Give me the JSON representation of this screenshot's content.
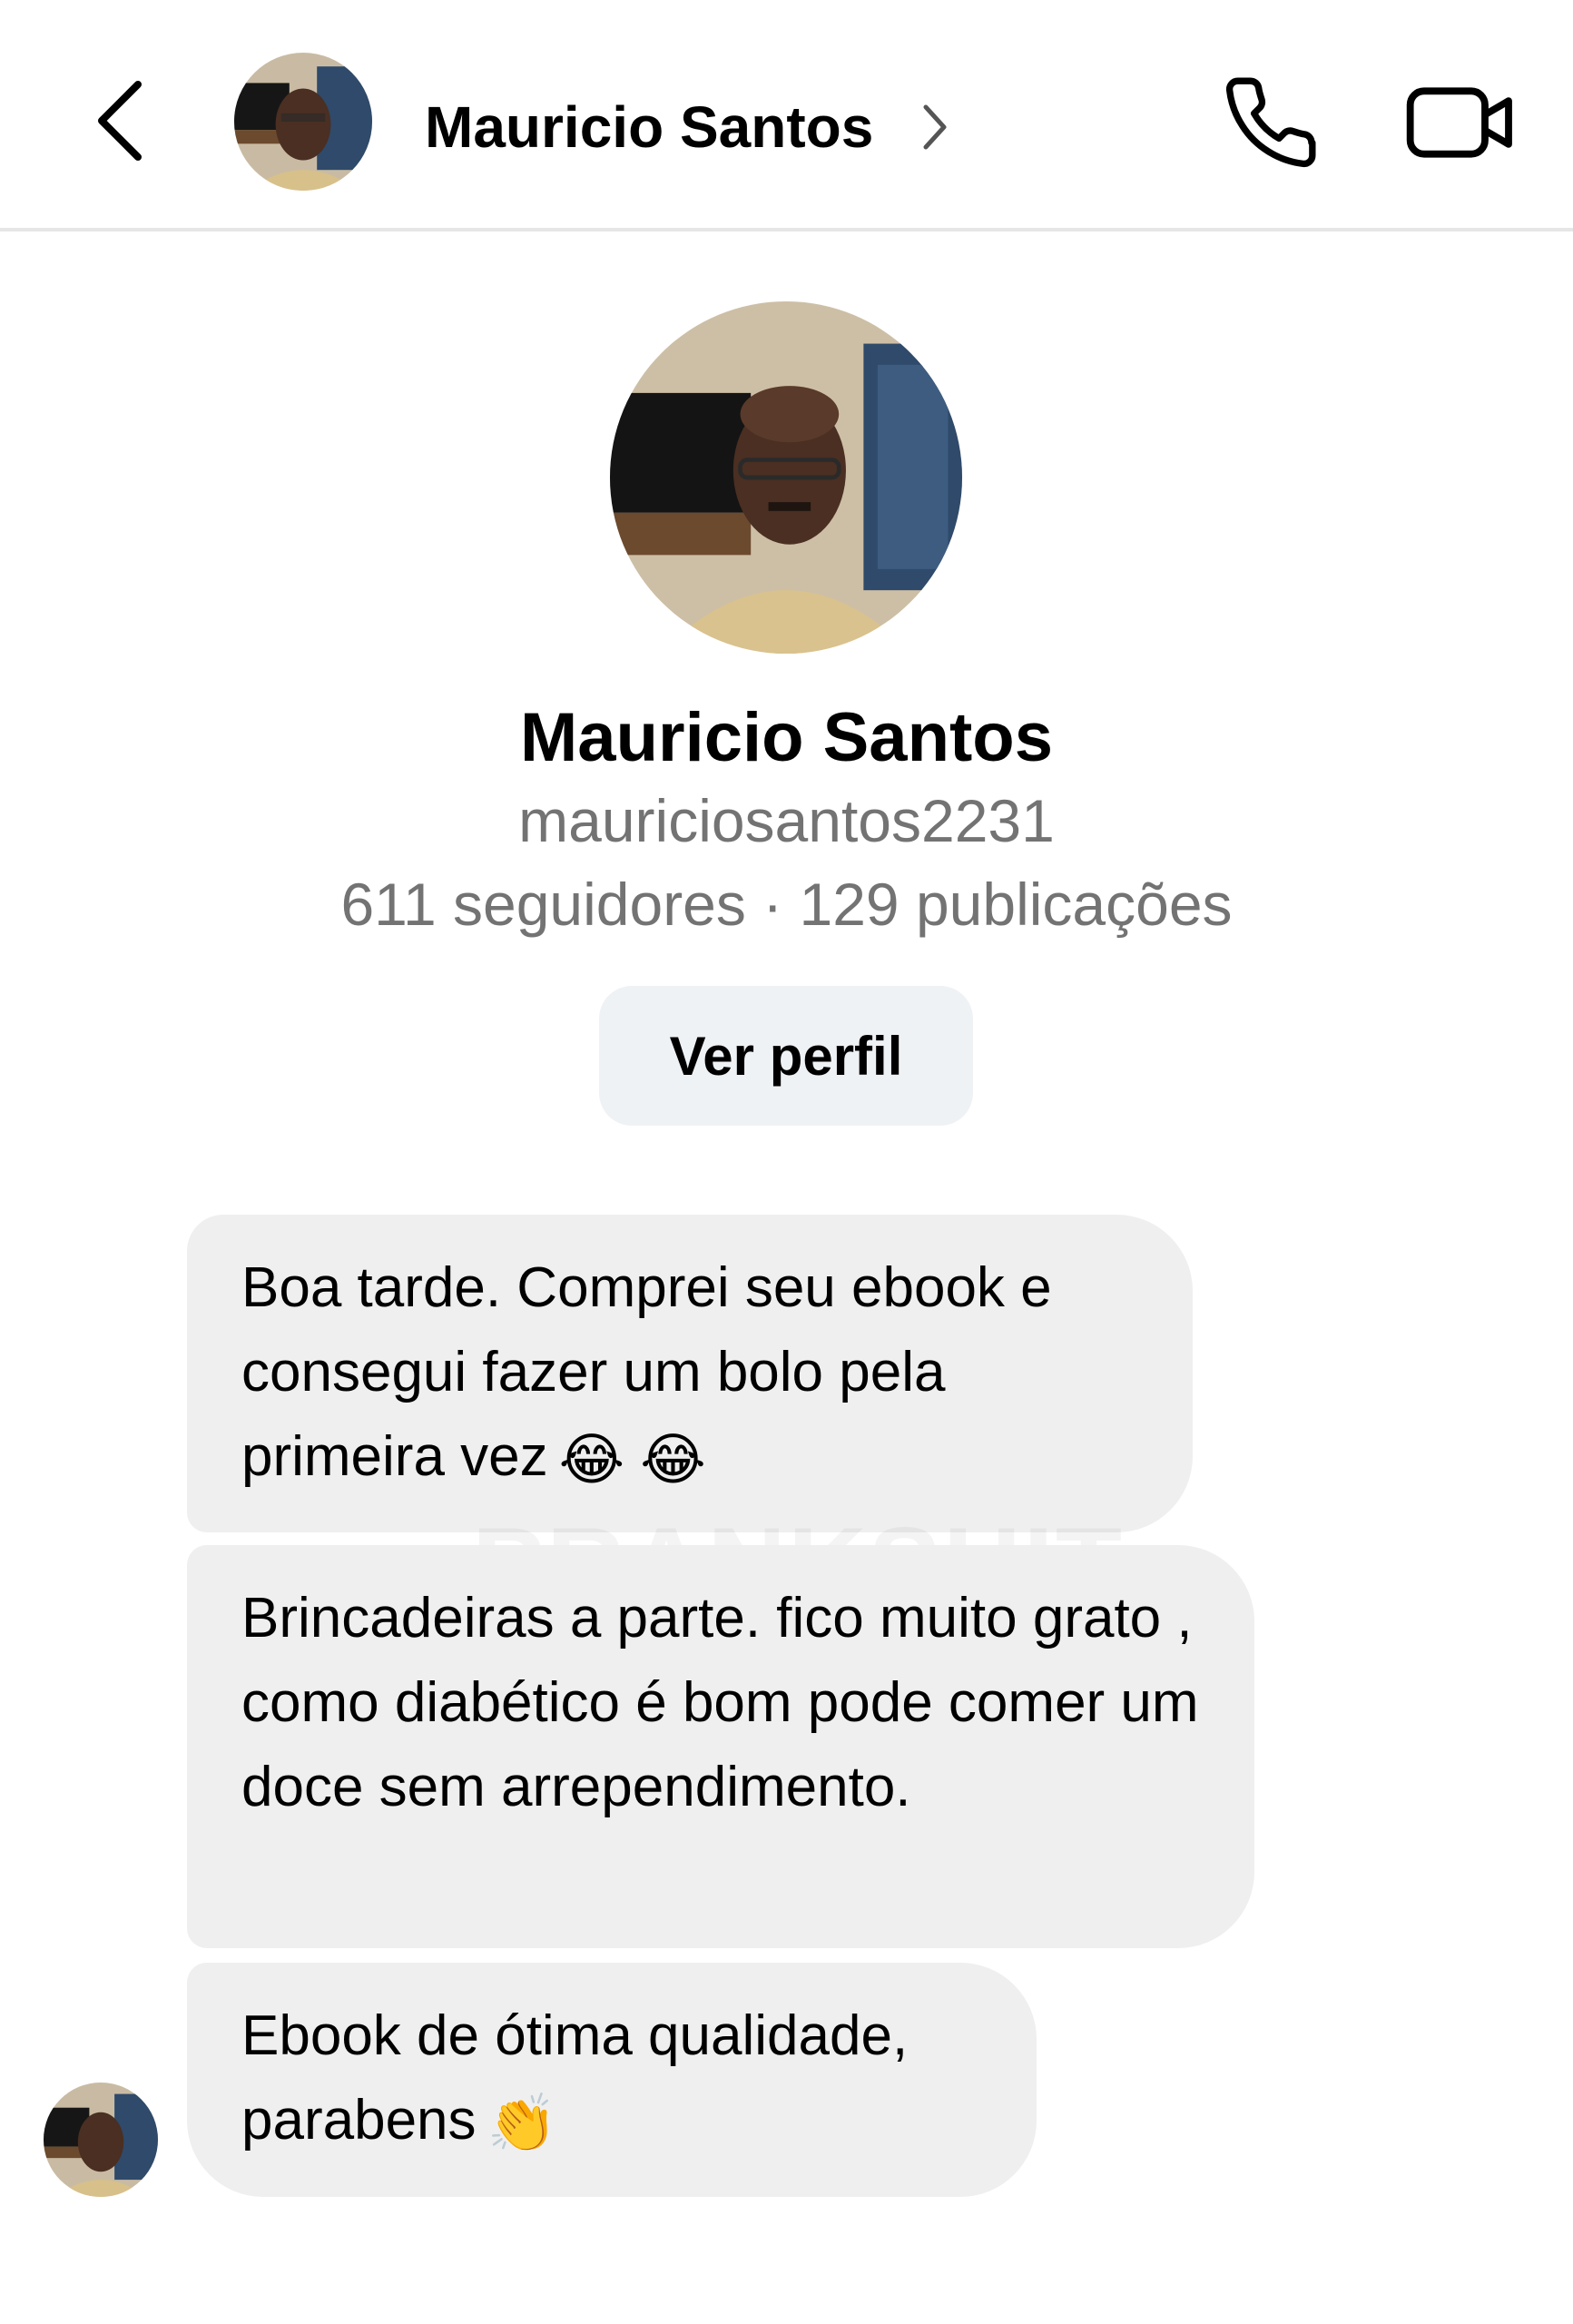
{
  "header": {
    "contact_name": "Mauricio Santos",
    "icons": {
      "back": "chevron-left-icon",
      "chevron": "chevron-right-icon",
      "call": "phone-icon",
      "video": "video-camera-icon"
    }
  },
  "profile": {
    "name": "Mauricio Santos",
    "username": "mauriciosantos2231",
    "stats": "611 seguidores · 129 publicações",
    "view_profile_label": "Ver perfil"
  },
  "messages": [
    {
      "text": "Boa tarde. Comprei seu ebook e consegui fazer um bolo pela primeira vez",
      "emoji": "😂 😂"
    },
    {
      "text": "Brincadeiras a parte. fico muito grato , como diabético é bom pode comer um doce sem arrependimento."
    },
    {
      "text": "Ebook de ótima qualidade, parabens",
      "emoji": "👏"
    }
  ],
  "watermark": "PRANKSHIT",
  "colors": {
    "bubble": "#efefef",
    "secondary_text": "#737373",
    "button_bg": "#eff2f5",
    "divider": "#e6e6e6"
  }
}
